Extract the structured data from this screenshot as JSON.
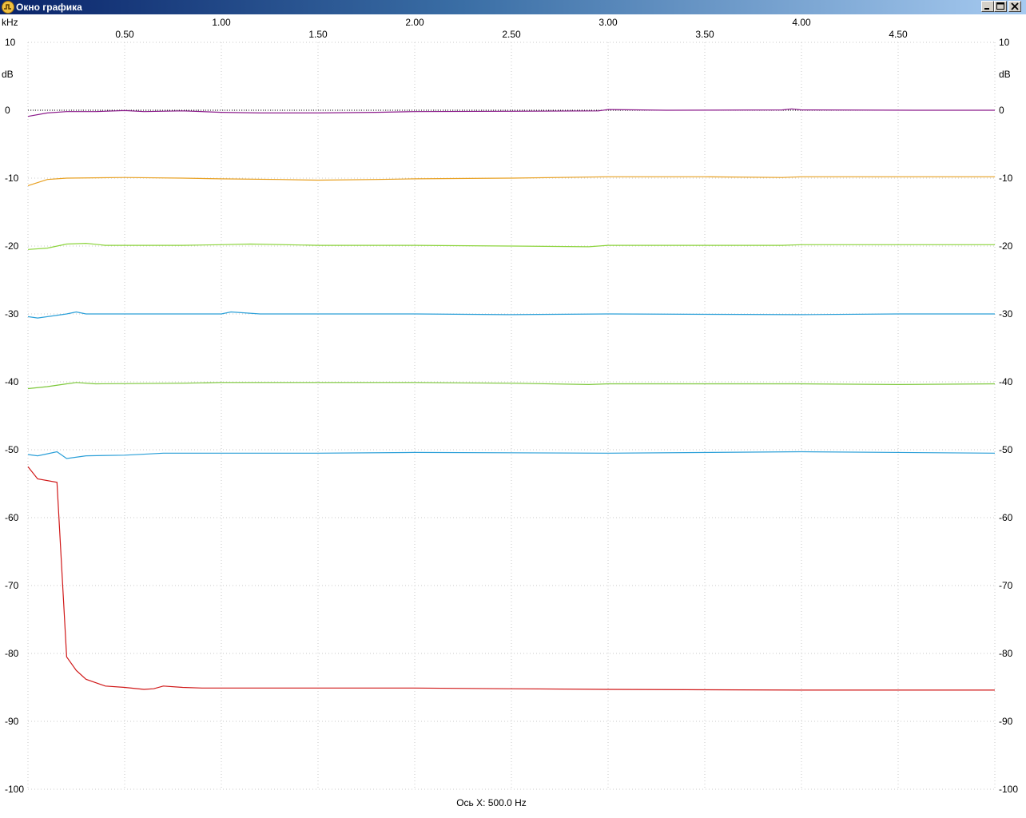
{
  "window": {
    "title": "Окно графика",
    "icon": "app-logo-icon",
    "controls": [
      "minimize-icon",
      "maximize-icon",
      "close-icon"
    ]
  },
  "axis_info": "Ось X: 500.0 Hz",
  "chart_data": {
    "type": "line",
    "xlabel": "kHz",
    "ylabel": "dB",
    "xlim": [
      0,
      5
    ],
    "ylim": [
      -100,
      10
    ],
    "x_ticks_upper": [
      "1.00",
      "2.00",
      "3.00",
      "4.00"
    ],
    "x_ticks_upper_values": [
      1,
      2,
      3,
      4
    ],
    "x_ticks_lower": [
      "0.50",
      "1.50",
      "2.50",
      "3.50",
      "4.50"
    ],
    "x_ticks_lower_values": [
      0.5,
      1.5,
      2.5,
      3.5,
      4.5
    ],
    "y_ticks": [
      "10",
      "0",
      "-10",
      "-20",
      "-30",
      "-40",
      "-50",
      "-60",
      "-70",
      "-80",
      "-90",
      "-100"
    ],
    "y_tick_values": [
      10,
      0,
      -10,
      -20,
      -30,
      -40,
      -50,
      -60,
      -70,
      -80,
      -90,
      -100
    ],
    "grid": true,
    "reference_line_db": 0,
    "series": [
      {
        "color": "#8b1a8b",
        "points": [
          [
            0,
            -0.9
          ],
          [
            0.1,
            -0.4
          ],
          [
            0.2,
            -0.2
          ],
          [
            0.35,
            -0.2
          ],
          [
            0.5,
            -0.05
          ],
          [
            0.6,
            -0.2
          ],
          [
            0.8,
            -0.1
          ],
          [
            1.0,
            -0.3
          ],
          [
            1.2,
            -0.4
          ],
          [
            1.5,
            -0.4
          ],
          [
            1.8,
            -0.3
          ],
          [
            2.0,
            -0.2
          ],
          [
            2.5,
            -0.15
          ],
          [
            2.95,
            -0.1
          ],
          [
            3.0,
            0.1
          ],
          [
            3.3,
            0.0
          ],
          [
            3.9,
            0.05
          ],
          [
            3.95,
            0.2
          ],
          [
            4.0,
            0.05
          ],
          [
            4.6,
            0.0
          ],
          [
            5.0,
            0.0
          ]
        ]
      },
      {
        "color": "#e8a020",
        "points": [
          [
            0,
            -11.1
          ],
          [
            0.1,
            -10.2
          ],
          [
            0.2,
            -10.0
          ],
          [
            0.5,
            -9.9
          ],
          [
            0.8,
            -10.0
          ],
          [
            1.0,
            -10.1
          ],
          [
            1.3,
            -10.2
          ],
          [
            1.5,
            -10.3
          ],
          [
            1.8,
            -10.2
          ],
          [
            2.0,
            -10.1
          ],
          [
            2.5,
            -10.0
          ],
          [
            3.0,
            -9.8
          ],
          [
            3.5,
            -9.8
          ],
          [
            3.9,
            -9.9
          ],
          [
            4.0,
            -9.8
          ],
          [
            5.0,
            -9.8
          ]
        ]
      },
      {
        "color": "#8cd43c",
        "points": [
          [
            0,
            -20.5
          ],
          [
            0.1,
            -20.3
          ],
          [
            0.2,
            -19.7
          ],
          [
            0.3,
            -19.6
          ],
          [
            0.4,
            -19.9
          ],
          [
            0.8,
            -19.9
          ],
          [
            1.0,
            -19.8
          ],
          [
            1.15,
            -19.7
          ],
          [
            1.5,
            -19.9
          ],
          [
            2.0,
            -19.9
          ],
          [
            2.5,
            -20.0
          ],
          [
            2.9,
            -20.1
          ],
          [
            3.0,
            -19.9
          ],
          [
            3.5,
            -19.9
          ],
          [
            3.9,
            -19.9
          ],
          [
            4.0,
            -19.8
          ],
          [
            5.0,
            -19.8
          ]
        ]
      },
      {
        "color": "#2a9fd8",
        "points": [
          [
            0,
            -30.4
          ],
          [
            0.05,
            -30.6
          ],
          [
            0.2,
            -30.0
          ],
          [
            0.25,
            -29.7
          ],
          [
            0.3,
            -30.0
          ],
          [
            1.0,
            -30.0
          ],
          [
            1.05,
            -29.7
          ],
          [
            1.2,
            -30.0
          ],
          [
            2.0,
            -30.0
          ],
          [
            2.5,
            -30.1
          ],
          [
            3.0,
            -30.0
          ],
          [
            4.0,
            -30.1
          ],
          [
            4.5,
            -30.0
          ],
          [
            5.0,
            -30.0
          ]
        ]
      },
      {
        "color": "#7cc83a",
        "points": [
          [
            0,
            -41.0
          ],
          [
            0.1,
            -40.7
          ],
          [
            0.2,
            -40.3
          ],
          [
            0.25,
            -40.1
          ],
          [
            0.35,
            -40.3
          ],
          [
            0.8,
            -40.2
          ],
          [
            1.0,
            -40.1
          ],
          [
            1.5,
            -40.1
          ],
          [
            2.0,
            -40.1
          ],
          [
            2.5,
            -40.2
          ],
          [
            2.9,
            -40.4
          ],
          [
            3.0,
            -40.3
          ],
          [
            4.0,
            -40.3
          ],
          [
            4.5,
            -40.4
          ],
          [
            5.0,
            -40.3
          ]
        ]
      },
      {
        "color": "#2a9fd8",
        "points": [
          [
            0,
            -50.7
          ],
          [
            0.05,
            -50.9
          ],
          [
            0.1,
            -50.6
          ],
          [
            0.15,
            -50.3
          ],
          [
            0.2,
            -51.3
          ],
          [
            0.3,
            -50.9
          ],
          [
            0.5,
            -50.8
          ],
          [
            0.7,
            -50.5
          ],
          [
            1.0,
            -50.5
          ],
          [
            1.5,
            -50.5
          ],
          [
            2.0,
            -50.4
          ],
          [
            3.0,
            -50.5
          ],
          [
            4.0,
            -50.3
          ],
          [
            5.0,
            -50.5
          ]
        ]
      },
      {
        "color": "#d01818",
        "points": [
          [
            0,
            -52.5
          ],
          [
            0.05,
            -54.3
          ],
          [
            0.15,
            -54.8
          ],
          [
            0.2,
            -80.5
          ],
          [
            0.25,
            -82.5
          ],
          [
            0.3,
            -83.8
          ],
          [
            0.4,
            -84.8
          ],
          [
            0.5,
            -85.0
          ],
          [
            0.6,
            -85.3
          ],
          [
            0.65,
            -85.2
          ],
          [
            0.7,
            -84.8
          ],
          [
            0.8,
            -85.0
          ],
          [
            0.9,
            -85.1
          ],
          [
            1.0,
            -85.1
          ],
          [
            2.0,
            -85.1
          ],
          [
            2.5,
            -85.2
          ],
          [
            3.0,
            -85.3
          ],
          [
            4.0,
            -85.4
          ],
          [
            5.0,
            -85.4
          ]
        ]
      }
    ]
  }
}
